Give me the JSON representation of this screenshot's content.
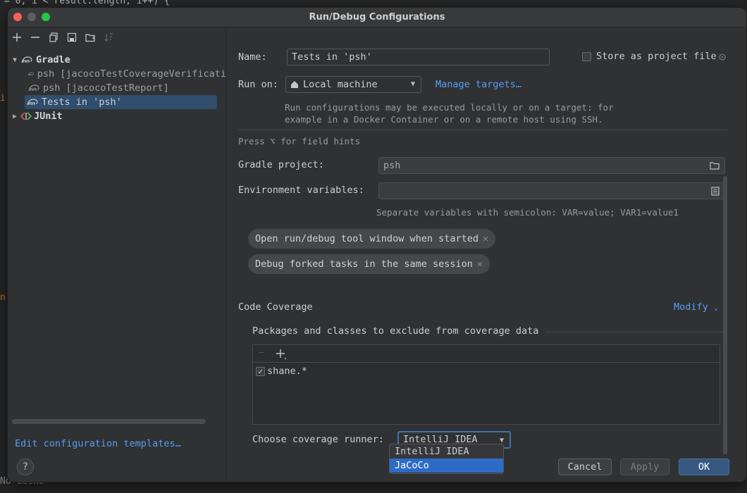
{
  "background": {
    "code_line": "= 0; i < result.length; i++) {",
    "code_num": "0",
    "bottom_text": "No Gecko"
  },
  "dialog": {
    "title": "Run/Debug Configurations"
  },
  "left": {
    "toolbar": [
      {
        "icon": "add-icon",
        "glyph": "+"
      },
      {
        "icon": "remove-icon",
        "glyph": "−"
      },
      {
        "icon": "copy-icon",
        "glyph": "⧉"
      },
      {
        "icon": "save-icon",
        "glyph": "▤"
      },
      {
        "icon": "folder-icon",
        "glyph": "▰"
      },
      {
        "icon": "sort-icon",
        "glyph": "⇅"
      }
    ],
    "tree": {
      "gradle_label": "Gradle",
      "items": [
        {
          "label": "psh [jacocoTestCoverageVerificati"
        },
        {
          "label": "psh [jacocoTestReport]"
        },
        {
          "label": "Tests in 'psh'"
        }
      ],
      "junit_label": "JUnit"
    },
    "edit_templates": "Edit configuration templates…",
    "help": "?"
  },
  "form": {
    "name_label": "Name:",
    "name_value": "Tests in 'psh'",
    "store_label": "Store as project file",
    "run_on_label": "Run on:",
    "run_on_value": "Local machine",
    "manage_targets": "Manage targets…",
    "run_on_hint_1": "Run configurations may be executed locally or on a target: for",
    "run_on_hint_2": "example in a Docker Container or on a remote host using SSH.",
    "field_hints": "Press ⌥ for field hints",
    "gradle_project_label": "Gradle project:",
    "gradle_project_value": "psh",
    "env_label": "Environment variables:",
    "env_value": "",
    "env_hint": "Separate variables with semicolon: VAR=value; VAR1=value1",
    "chips": [
      "Open run/debug tool window when started",
      "Debug forked tasks in the same session"
    ],
    "coverage_title": "Code Coverage",
    "modify": "Modify",
    "exclude_title": "Packages and classes to exclude from coverage data",
    "exclude_items": [
      {
        "label": "shane.*",
        "checked": true
      }
    ],
    "runner_label": "Choose coverage runner:",
    "runner_value": "IntelliJ IDEA",
    "runner_options": [
      "IntelliJ IDEA",
      "JaCoCo"
    ],
    "runner_highlight": "JaCoCo"
  },
  "buttons": {
    "cancel": "Cancel",
    "apply": "Apply",
    "ok": "OK"
  }
}
